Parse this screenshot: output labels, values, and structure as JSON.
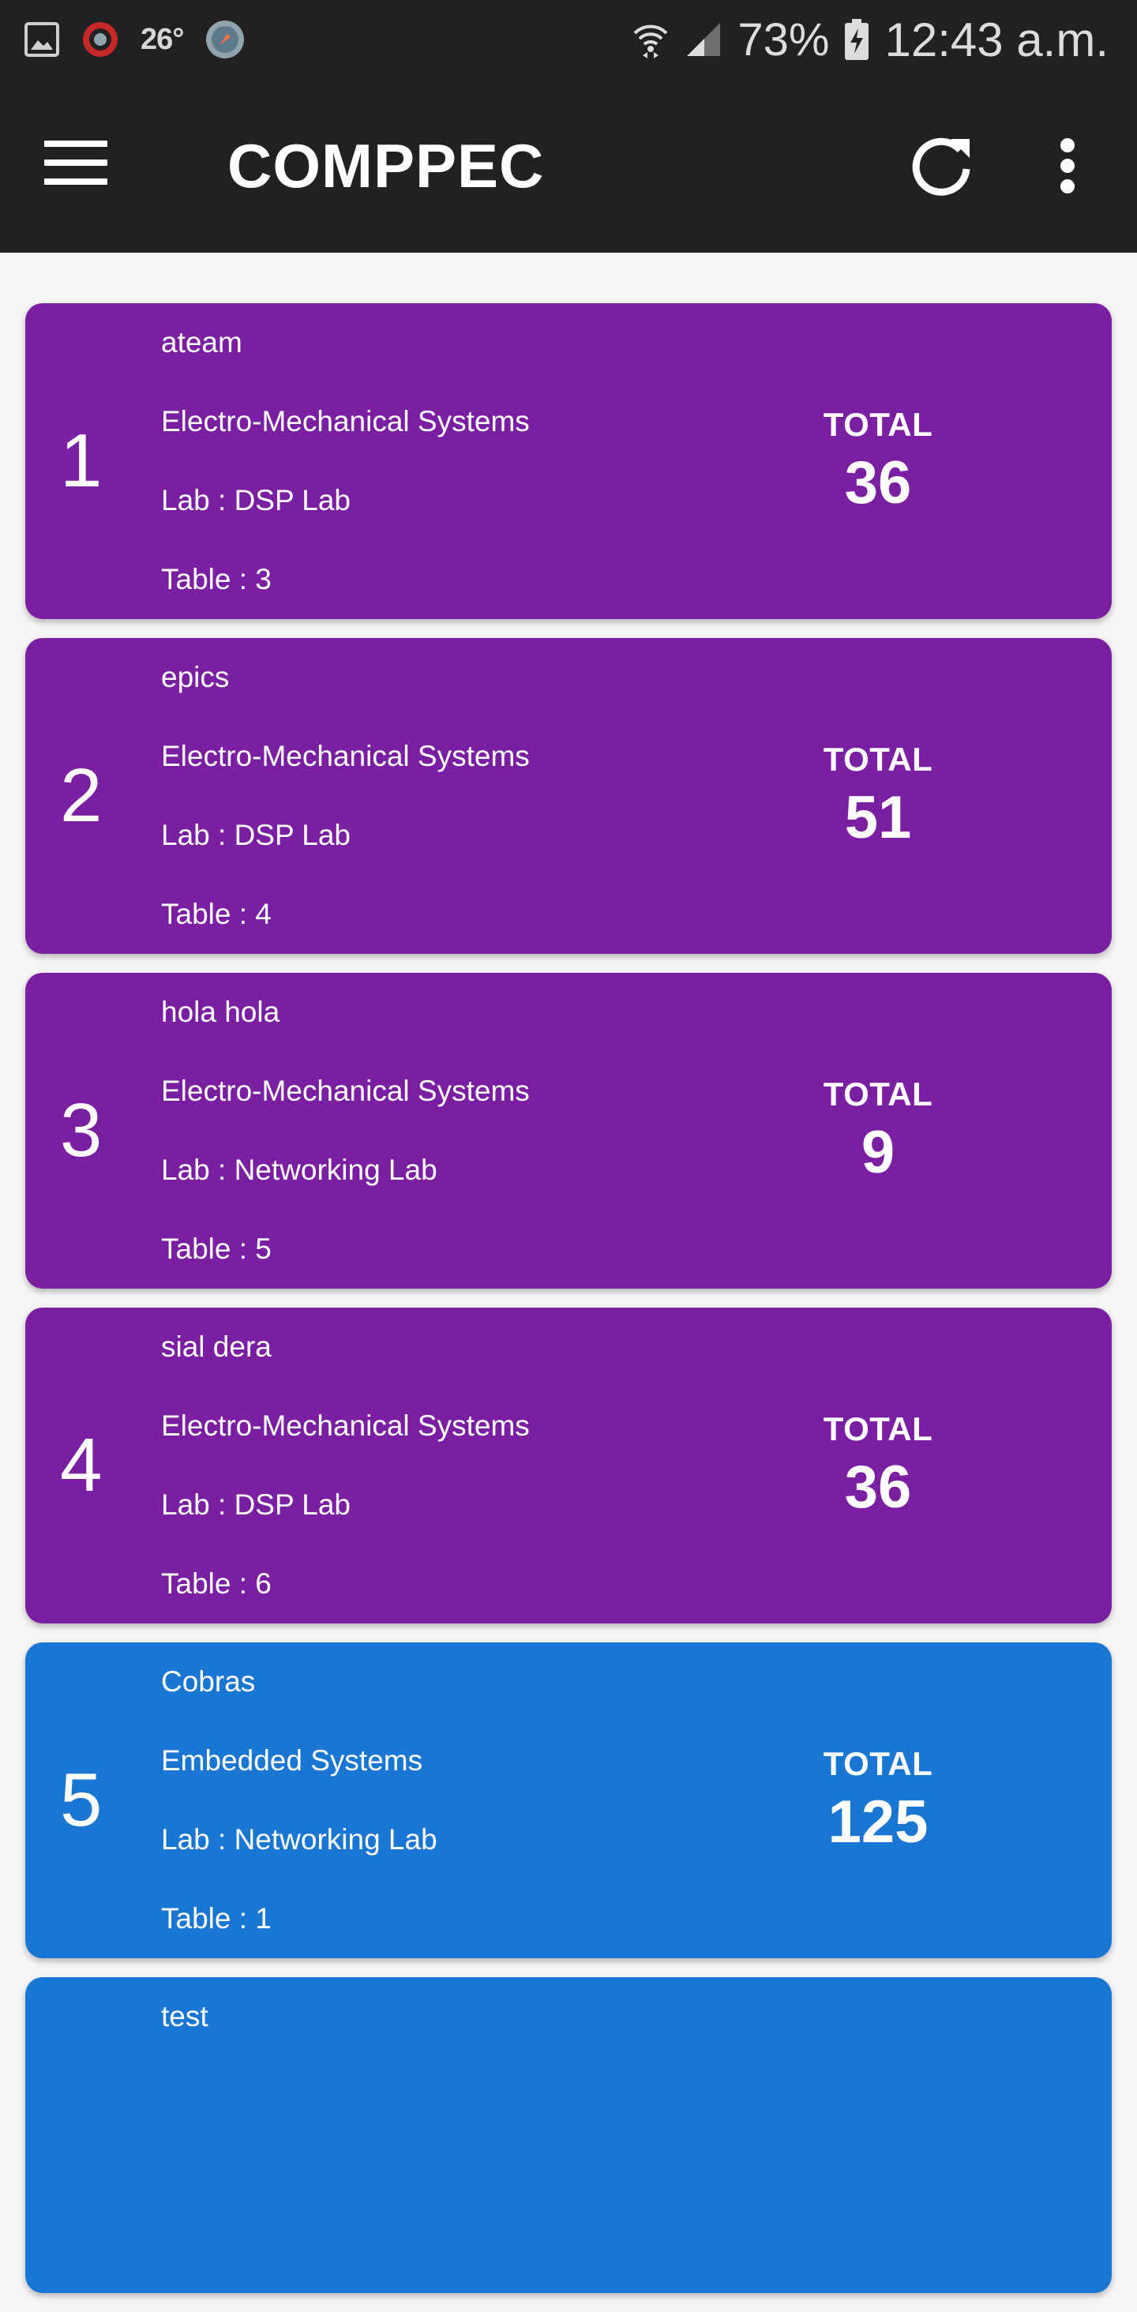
{
  "status_bar": {
    "temperature": "26°",
    "battery": "73%",
    "time": "12:43 a.m."
  },
  "app_bar": {
    "title": "COMPPEC"
  },
  "colors": {
    "app_bar": "#212121",
    "card_purple": "#7b1fa2",
    "card_blue": "#1976d2"
  },
  "teams": [
    {
      "rank": "1",
      "name": "ateam",
      "category": "Electro-Mechanical Systems",
      "lab": "Lab : DSP Lab",
      "table": "Table : 3",
      "total_label": "TOTAL",
      "total": "36",
      "color": "#7b1fa2"
    },
    {
      "rank": "2",
      "name": "epics",
      "category": "Electro-Mechanical Systems",
      "lab": "Lab : DSP Lab",
      "table": "Table : 4",
      "total_label": "TOTAL",
      "total": "51",
      "color": "#7b1fa2"
    },
    {
      "rank": "3",
      "name": "hola hola",
      "category": "Electro-Mechanical Systems",
      "lab": "Lab : Networking Lab",
      "table": "Table : 5",
      "total_label": "TOTAL",
      "total": "9",
      "color": "#7b1fa2"
    },
    {
      "rank": "4",
      "name": "sial dera",
      "category": "Electro-Mechanical Systems",
      "lab": "Lab : DSP Lab",
      "table": "Table : 6",
      "total_label": "TOTAL",
      "total": "36",
      "color": "#7b1fa2"
    },
    {
      "rank": "5",
      "name": "Cobras",
      "category": "Embedded Systems",
      "lab": "Lab : Networking Lab",
      "table": "Table : 1",
      "total_label": "TOTAL",
      "total": "125",
      "color": "#1976d2"
    },
    {
      "rank": "",
      "name": "test",
      "category": "",
      "lab": "",
      "table": "",
      "total_label": "",
      "total": "",
      "color": "#1976d2"
    }
  ]
}
